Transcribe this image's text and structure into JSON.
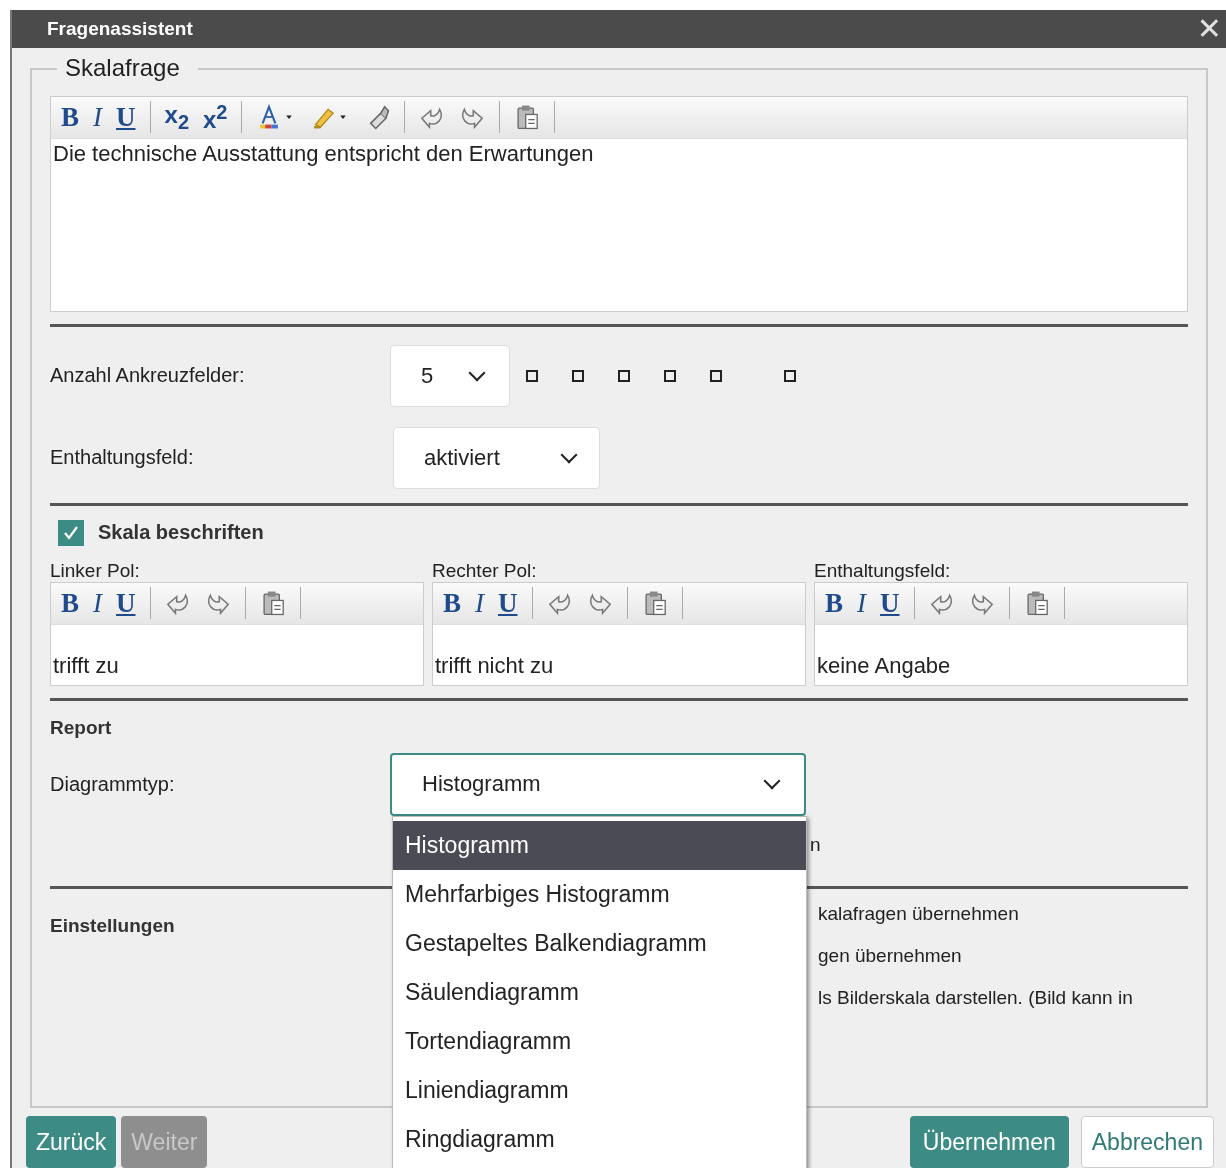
{
  "window": {
    "title": "Fragenassistent",
    "close": "✕"
  },
  "legend": "Skalafrage",
  "question_editor": {
    "toolbar": [
      {
        "kind": "bold",
        "label": "B"
      },
      {
        "kind": "italic",
        "label": "I"
      },
      {
        "kind": "underline",
        "label": "U"
      },
      {
        "kind": "separator"
      },
      {
        "kind": "rich",
        "label": "x$_{2}$"
      },
      {
        "kind": "rich",
        "label": "x$^{2}$"
      },
      {
        "kind": "separator"
      },
      {
        "kind": "font-color"
      },
      {
        "kind": "caret"
      },
      {
        "kind": "highlight"
      },
      {
        "kind": "caret"
      },
      {
        "kind": "eraser"
      },
      {
        "kind": "separator"
      },
      {
        "kind": "undo"
      },
      {
        "kind": "redo"
      },
      {
        "kind": "separator"
      },
      {
        "kind": "paste"
      },
      {
        "kind": "separator"
      }
    ],
    "text": "Die technische Ausstattung entspricht den Erwartungen"
  },
  "count_row": {
    "label": "Anzahl Ankreuzfelder:",
    "value": "5",
    "boxes": [
      {
        "kind": "scale",
        "checked": false
      },
      {
        "kind": "scale",
        "checked": false
      },
      {
        "kind": "scale",
        "checked": false
      },
      {
        "kind": "scale",
        "checked": false
      },
      {
        "kind": "scale",
        "checked": false
      },
      {
        "kind": "abstention",
        "checked": false
      }
    ]
  },
  "abstention_row": {
    "label": "Enthaltungsfeld:",
    "value": "aktiviert"
  },
  "label_scale": {
    "label": "Skala beschriften",
    "checked": true
  },
  "pole_editors": [
    {
      "label": "Linker Pol:",
      "text": "trifft zu",
      "toolbar": [
        {
          "kind": "bold",
          "label": "B"
        },
        {
          "kind": "italic",
          "label": "I"
        },
        {
          "kind": "underline",
          "label": "U"
        },
        {
          "kind": "separator"
        },
        {
          "kind": "undo"
        },
        {
          "kind": "redo"
        },
        {
          "kind": "separator"
        },
        {
          "kind": "paste"
        },
        {
          "kind": "separator"
        }
      ]
    },
    {
      "label": "Rechter Pol:",
      "text": "trifft nicht zu",
      "toolbar": [
        {
          "kind": "bold",
          "label": "B"
        },
        {
          "kind": "italic",
          "label": "I"
        },
        {
          "kind": "underline",
          "label": "U"
        },
        {
          "kind": "separator"
        },
        {
          "kind": "undo"
        },
        {
          "kind": "redo"
        },
        {
          "kind": "separator"
        },
        {
          "kind": "paste"
        },
        {
          "kind": "separator"
        }
      ]
    },
    {
      "label": "Enthaltungsfeld:",
      "text": "keine Angabe",
      "toolbar": [
        {
          "kind": "bold",
          "label": "B"
        },
        {
          "kind": "italic",
          "label": "I"
        },
        {
          "kind": "underline",
          "label": "U"
        },
        {
          "kind": "separator"
        },
        {
          "kind": "undo"
        },
        {
          "kind": "redo"
        },
        {
          "kind": "separator"
        },
        {
          "kind": "paste"
        },
        {
          "kind": "separator"
        }
      ]
    }
  ],
  "report": {
    "heading": "Report",
    "chart_type_label": "Diagrammtyp:",
    "chart_type_value": "Histogramm",
    "hidden_row_fragment": "n",
    "options": [
      {
        "label": "Histogramm",
        "selected": true
      },
      {
        "label": "Mehrfarbiges Histogramm",
        "selected": false
      },
      {
        "label": "Gestapeltes Balkendiagramm",
        "selected": false
      },
      {
        "label": "Säulendiagramm",
        "selected": false
      },
      {
        "label": "Tortendiagramm",
        "selected": false
      },
      {
        "label": "Liniendiagramm",
        "selected": false
      },
      {
        "label": "Ringdiagramm",
        "selected": false
      }
    ]
  },
  "settings": {
    "heading": "Einstellungen",
    "fragments": [
      "kalafragen übernehmen",
      "gen übernehmen",
      "ls Bilderskala darstellen. (Bild kann in"
    ]
  },
  "buttons_left": [
    {
      "label": "Zurück",
      "disabled": false
    },
    {
      "label": "Weiter",
      "disabled": true
    }
  ],
  "buttons_right": [
    {
      "label": "Übernehmen",
      "kind": "primary"
    },
    {
      "label": "Abbrechen",
      "kind": "secondary"
    }
  ]
}
